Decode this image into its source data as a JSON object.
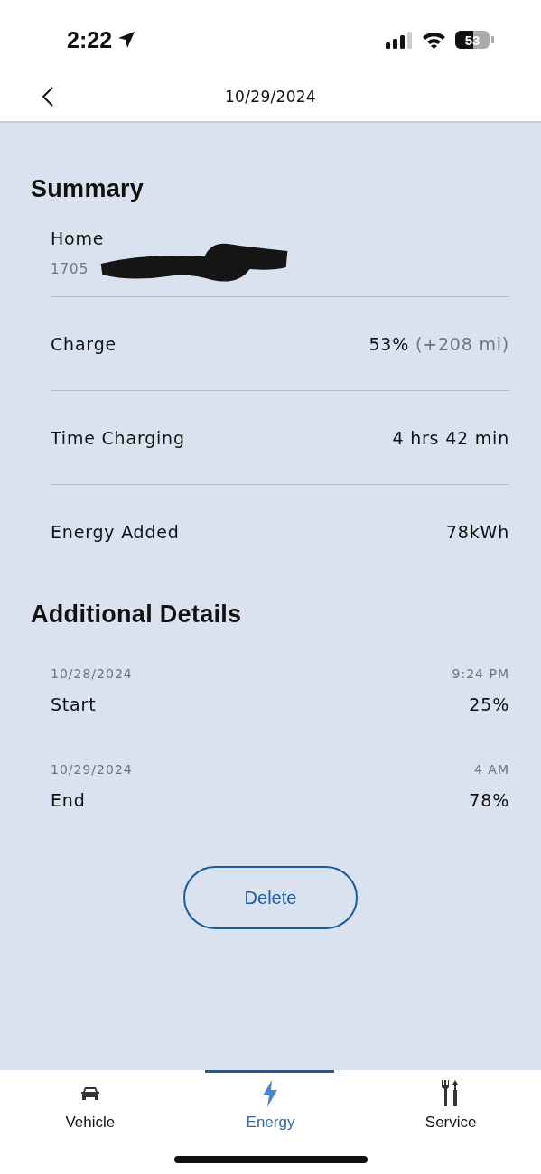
{
  "status_bar": {
    "time": "2:22",
    "battery": "53"
  },
  "header": {
    "title": "10/29/2024"
  },
  "summary": {
    "title": "Summary",
    "location": {
      "name": "Home",
      "address": "1705"
    },
    "rows": [
      {
        "label": "Charge",
        "value": "53%",
        "note": "(+208 mi)"
      },
      {
        "label": "Time Charging",
        "value": "4 hrs 42 min"
      },
      {
        "label": "Energy Added",
        "value": "78kWh"
      }
    ]
  },
  "details": {
    "title": "Additional Details",
    "rows": [
      {
        "date": "10/28/2024",
        "time": "9:24 PM",
        "label": "Start",
        "value": "25%"
      },
      {
        "date": "10/29/2024",
        "time": "4 AM",
        "label": "End",
        "value": "78%"
      }
    ]
  },
  "delete_button": "Delete",
  "nav": [
    {
      "kind": "car",
      "label": "Vehicle",
      "selected": false
    },
    {
      "kind": "bolt",
      "label": "Energy",
      "selected": true
    },
    {
      "kind": "tools",
      "label": "Service",
      "selected": false
    }
  ]
}
